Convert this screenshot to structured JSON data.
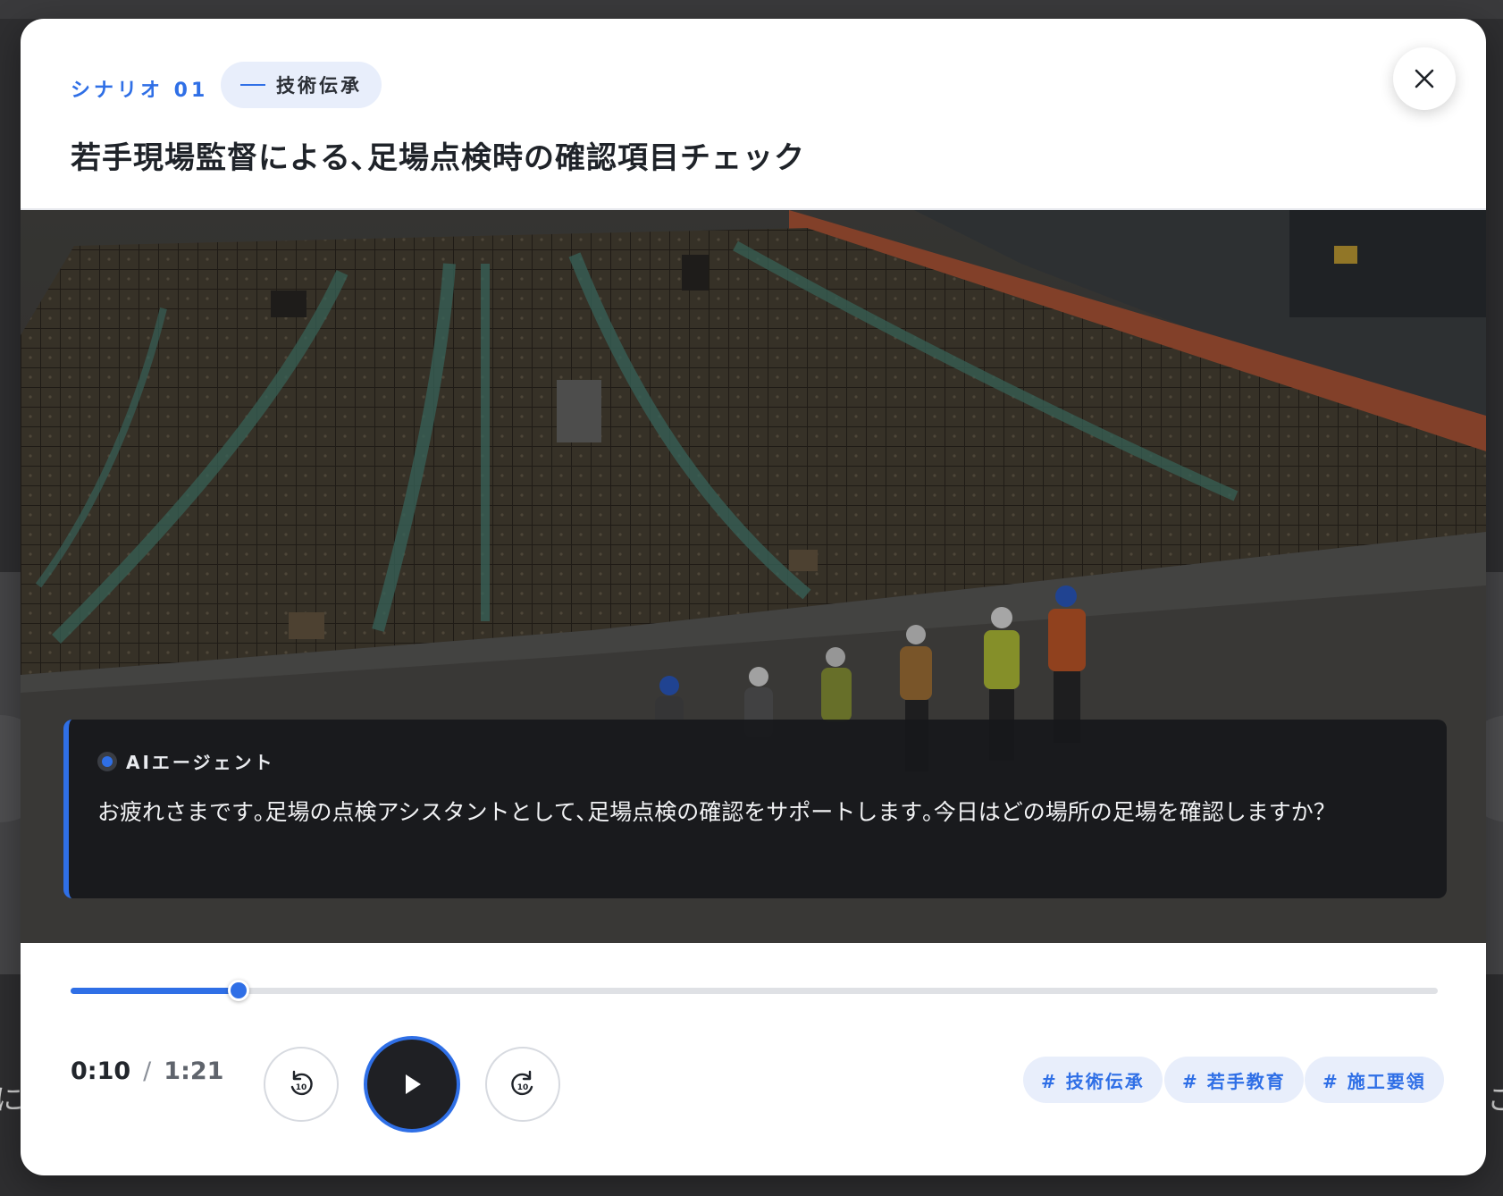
{
  "backdrop": {
    "left_text": "によ",
    "right_text": "こ"
  },
  "header": {
    "scenario_label": "シナリオ 01",
    "category": "技術伝承",
    "title": "若手現場監督による､足場点検時の確認項目チェック"
  },
  "subtitle": {
    "speaker": "AIエージェント",
    "text": "お疲れさまです｡足場の点検アシスタントとして､足場点検の確認をサポートします｡今日はどの場所の足場を確認しますか？"
  },
  "player": {
    "current_time": "0:10",
    "separator": "/",
    "total_time": "1:21",
    "progress_fraction": 0.123,
    "skip_back_seconds": "10",
    "skip_forward_seconds": "10"
  },
  "tags": [
    "# 技術伝承",
    "# 若手教育",
    "# 施工要領"
  ],
  "colors": {
    "accent": "#2f6fe6",
    "tag_bg": "#e8eefb",
    "play_bg": "#1f2024"
  }
}
